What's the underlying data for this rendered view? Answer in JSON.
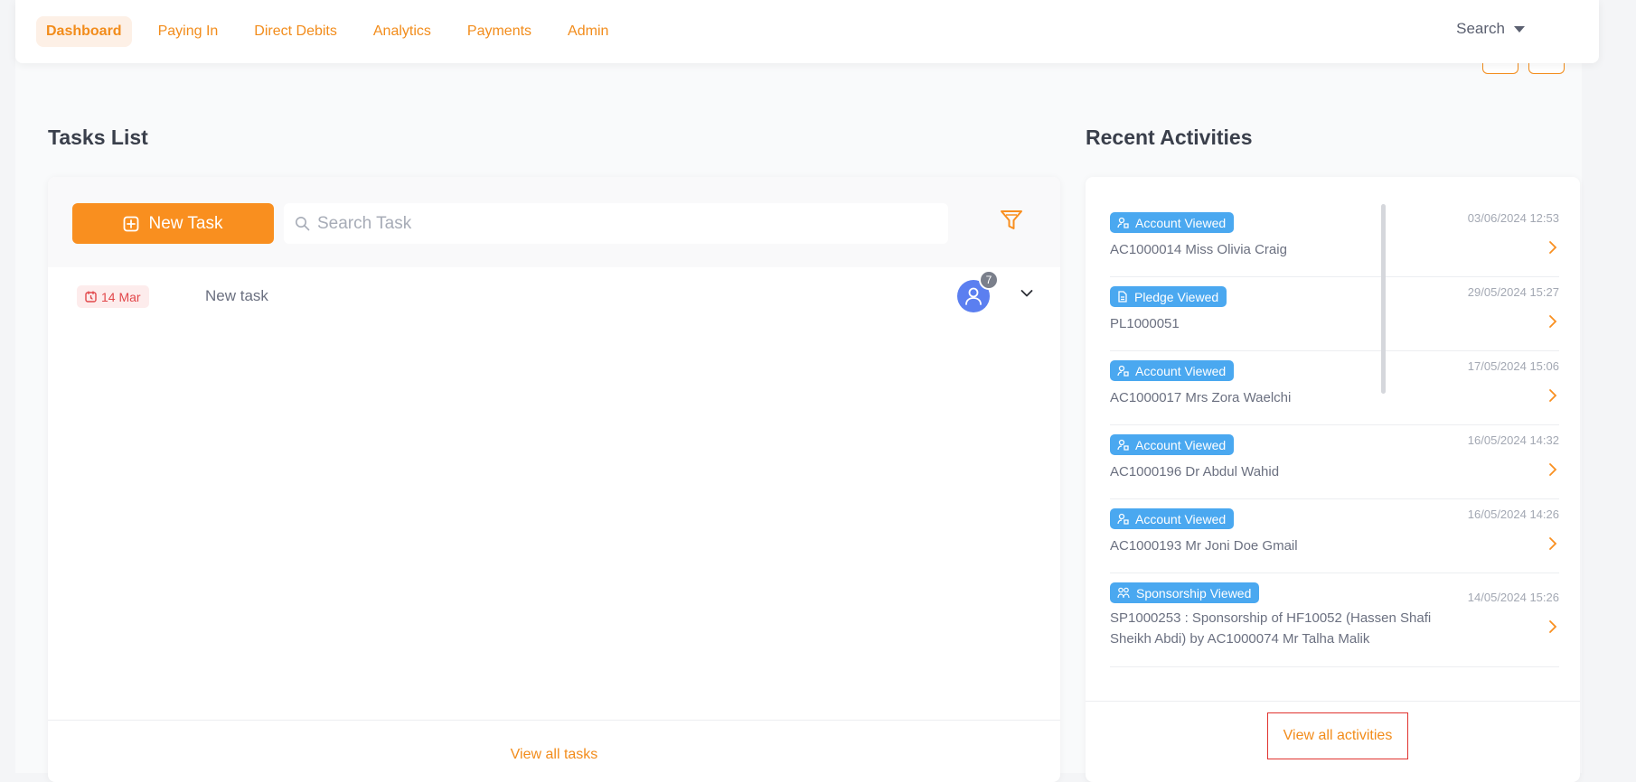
{
  "nav": {
    "items": [
      {
        "label": "Dashboard",
        "active": true
      },
      {
        "label": "Paying In",
        "active": false
      },
      {
        "label": "Direct Debits",
        "active": false
      },
      {
        "label": "Analytics",
        "active": false
      },
      {
        "label": "Payments",
        "active": false
      },
      {
        "label": "Admin",
        "active": false
      }
    ],
    "search_label": "Search"
  },
  "tasks": {
    "title": "Tasks List",
    "new_task_label": "New Task",
    "search_placeholder": "Search Task",
    "rows": [
      {
        "date": "14 Mar",
        "name": "New task",
        "assignee_count": "7"
      }
    ],
    "view_all_label": "View all tasks"
  },
  "activities": {
    "title": "Recent Activities",
    "items": [
      {
        "tag": "Account Viewed",
        "icon": "account-icon",
        "time": "03/06/2024 12:53",
        "desc": "AC1000014 Miss Olivia Craig"
      },
      {
        "tag": "Pledge Viewed",
        "icon": "pledge-icon",
        "time": "29/05/2024 15:27",
        "desc": "PL1000051"
      },
      {
        "tag": "Account Viewed",
        "icon": "account-icon",
        "time": "17/05/2024 15:06",
        "desc": "AC1000017 Mrs Zora Waelchi"
      },
      {
        "tag": "Account Viewed",
        "icon": "account-icon",
        "time": "16/05/2024 14:32",
        "desc": "AC1000196 Dr Abdul Wahid"
      },
      {
        "tag": "Account Viewed",
        "icon": "account-icon",
        "time": "16/05/2024 14:26",
        "desc": "AC1000193 Mr Joni Doe Gmail"
      },
      {
        "tag": "Sponsorship Viewed",
        "icon": "sponsorship-icon",
        "time": "14/05/2024 15:26",
        "desc": "SP1000253 : Sponsorship of HF10052 (Hassen Shafi Sheikh Abdi) by AC1000074 Mr Talha Malik"
      }
    ],
    "view_all_label": "View all activities"
  },
  "colors": {
    "accent": "#f98f1f",
    "tag_blue": "#4aa8f0",
    "date_red": "#e2474a",
    "avatar_blue": "#5b7ff0"
  }
}
